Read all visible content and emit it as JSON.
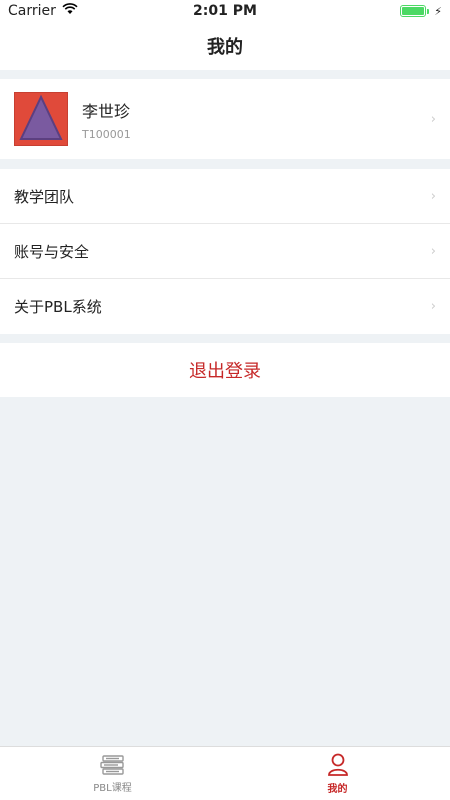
{
  "status_bar": {
    "carrier": "Carrier",
    "time": "2:01 PM"
  },
  "nav": {
    "title": "我的"
  },
  "profile": {
    "name": "李世珍",
    "id": "T100001"
  },
  "menu": {
    "items": [
      {
        "label": "教学团队"
      },
      {
        "label": "账号与安全"
      },
      {
        "label": "关于PBL系统"
      }
    ]
  },
  "logout": {
    "label": "退出登录"
  },
  "tabs": [
    {
      "label": "PBL课程",
      "icon": "books-icon",
      "active": false
    },
    {
      "label": "我的",
      "icon": "user-icon",
      "active": true
    }
  ],
  "colors": {
    "accent": "#c62828",
    "battery": "#4cd964",
    "background": "#eef2f5"
  }
}
